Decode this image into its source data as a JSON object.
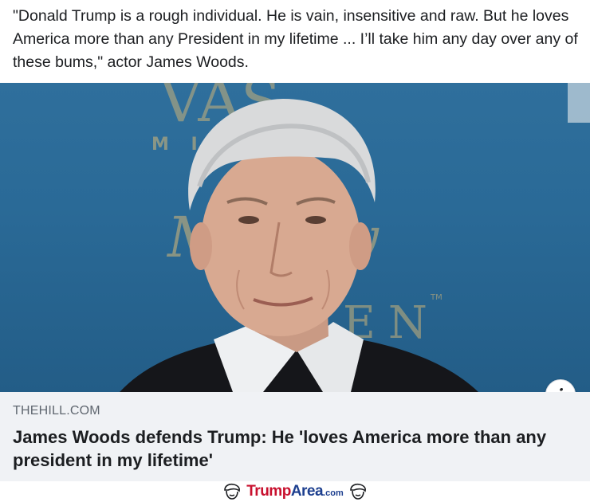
{
  "post": {
    "text": "\"Donald Trump is a rough individual. He is vain, insensitive and raw. But he loves America more than any President in my lifetime ... I’ll take him any day over any of these bums,\" actor James Woods."
  },
  "link": {
    "image_backdrop": {
      "letters_top": "VAS",
      "letters_small": "M        INE",
      "script": "Murray",
      "letters_bottom": "EN",
      "tm": "TM"
    },
    "domain": "THEHILL.COM",
    "headline": "James Woods defends Trump: He 'loves America more than any president in my lifetime'",
    "info_icon": "i"
  },
  "watermark": {
    "trump": "Trump",
    "area": "Area",
    "com": ".com"
  },
  "colors": {
    "backdrop_blue": "#2a6a97",
    "backdrop_gold": "#c9b27a",
    "watermark_red": "#c8102e",
    "watermark_blue": "#1d3f8f"
  }
}
